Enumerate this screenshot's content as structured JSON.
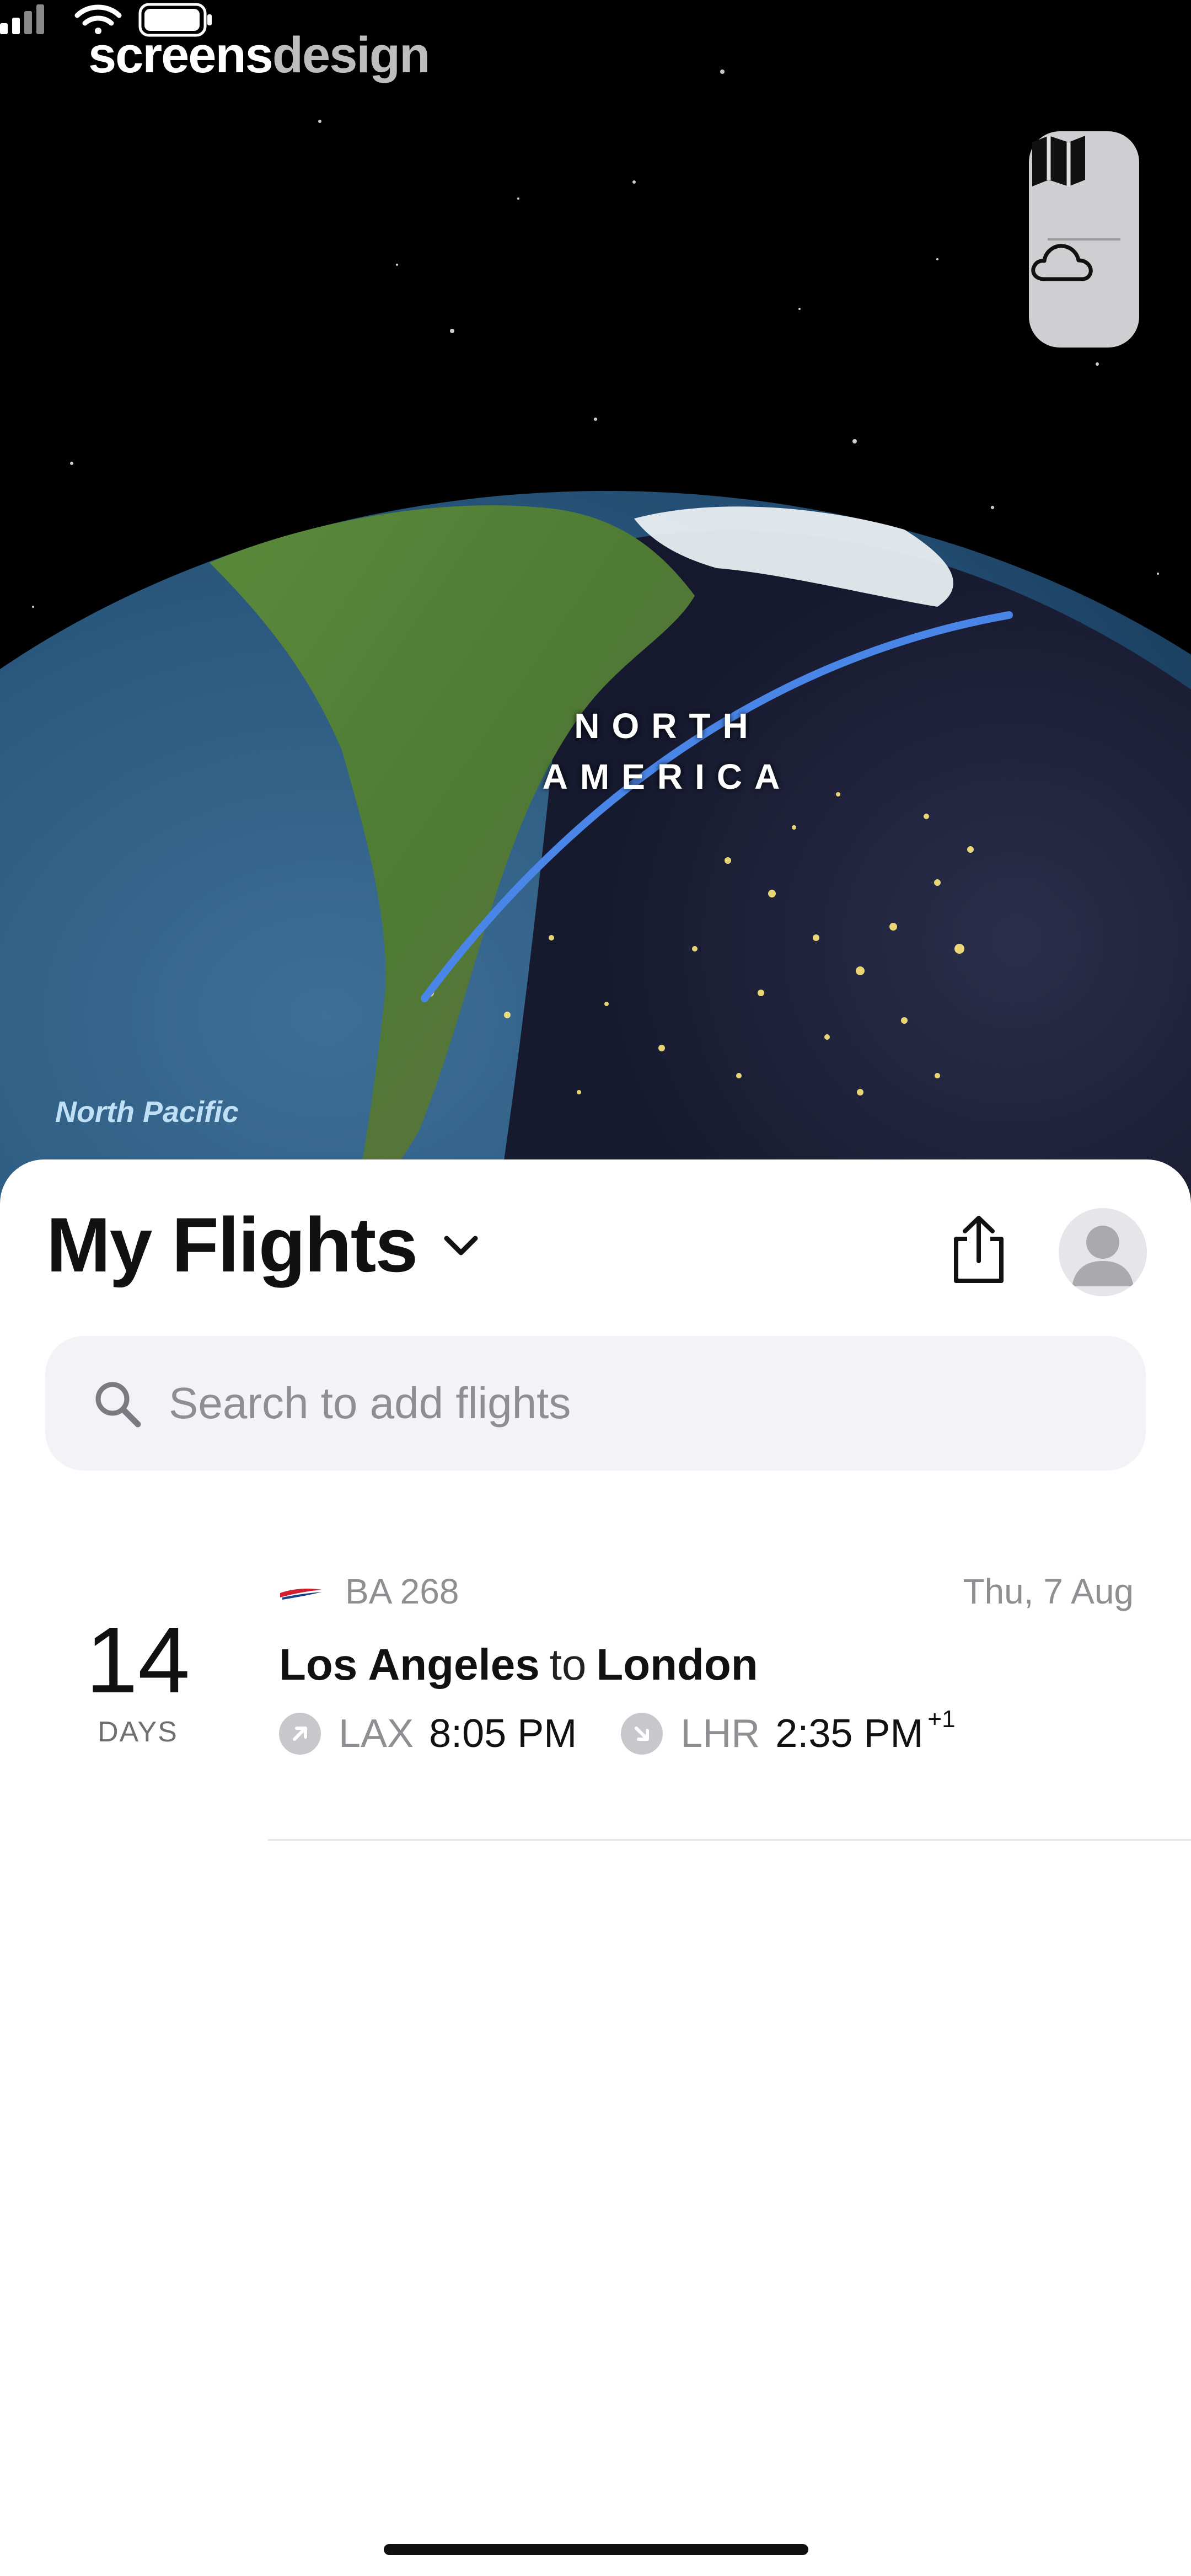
{
  "watermark": {
    "part1": "screens",
    "part2": "design"
  },
  "status_bar": {
    "icons": [
      "cellular-signal-icon",
      "wifi-icon",
      "battery-icon"
    ]
  },
  "map": {
    "continent_label": "NORTH AMERICA",
    "ocean_label": "North Pacific",
    "controls": [
      "map-mode-icon",
      "weather-cloud-icon"
    ],
    "route_color": "#4a86e8"
  },
  "sheet": {
    "title": "My Flights",
    "title_icon": "chevron-down-icon",
    "share_icon": "share-icon",
    "avatar_icon": "person-avatar-icon"
  },
  "search": {
    "placeholder": "Search to add flights",
    "value": ""
  },
  "flights": [
    {
      "countdown": "14",
      "countdown_unit": "DAYS",
      "airline_logo": "british-airways-logo-icon",
      "flight_number": "BA 268",
      "date": "Thu, 7 Aug",
      "origin_city": "Los Angeles",
      "connector": "to",
      "destination_city": "London",
      "departure": {
        "code": "LAX",
        "time": "8:05 PM",
        "icon": "takeoff-arrow-icon"
      },
      "arrival": {
        "code": "LHR",
        "time": "2:35 PM",
        "day_offset": "+1",
        "icon": "landing-arrow-icon"
      }
    }
  ],
  "colors": {
    "accent_route": "#4a86e8",
    "sheet_background": "#ffffff",
    "search_background": "#f2f2f7",
    "secondary_text": "#8e8e93"
  }
}
